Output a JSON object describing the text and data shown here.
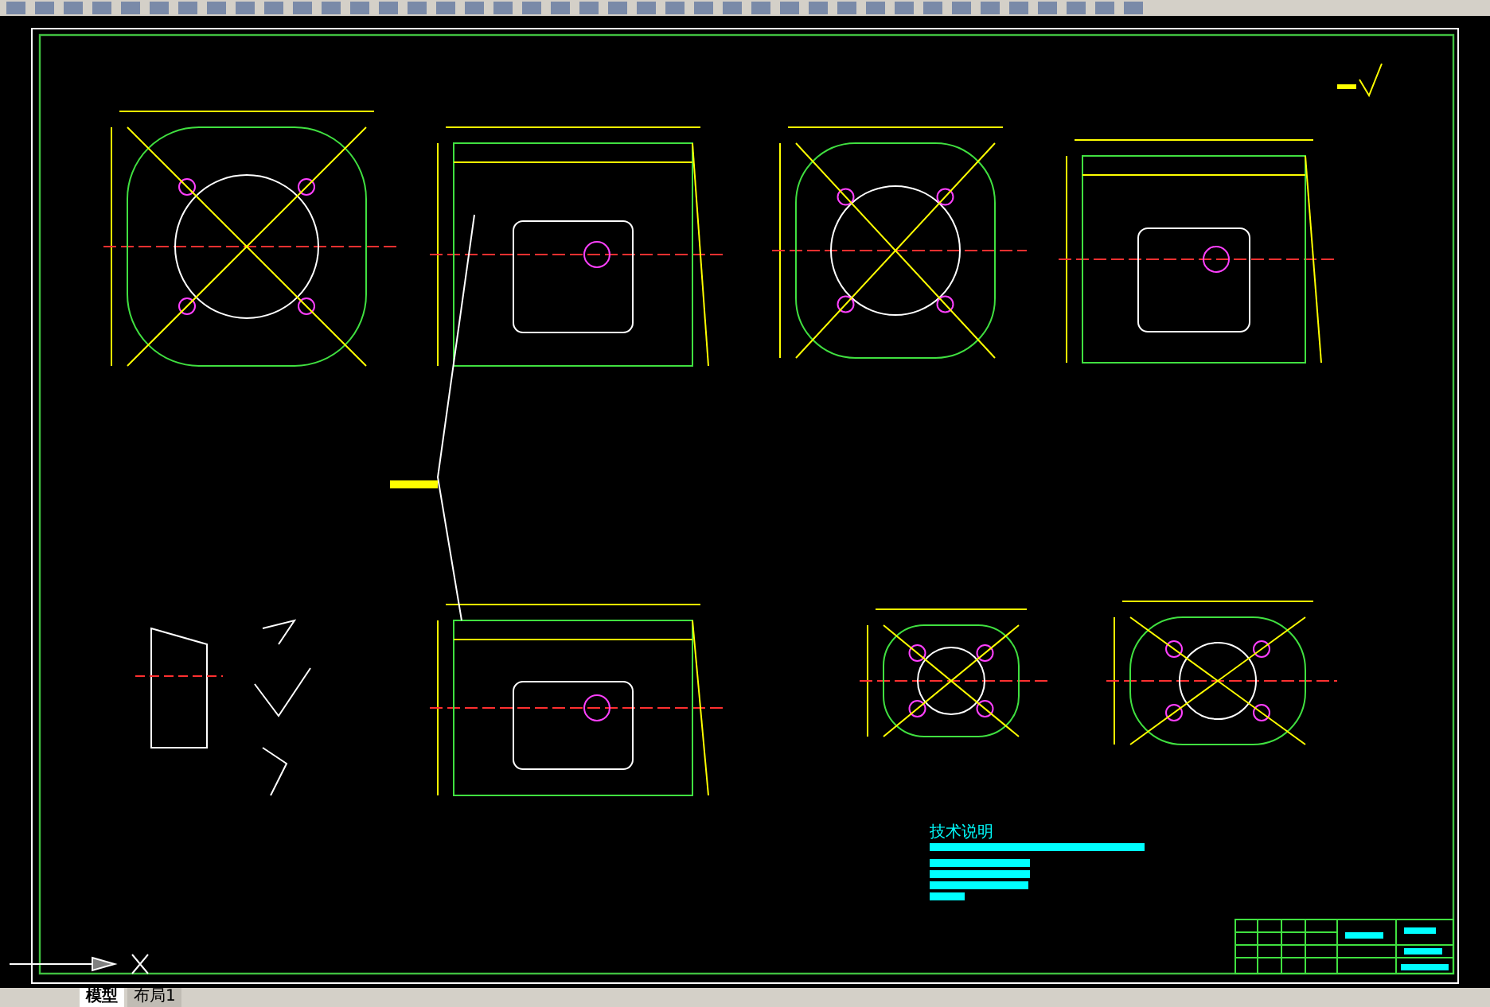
{
  "drawing": {
    "notes_heading": "技术说明"
  },
  "layout_tabs": [
    {
      "label": "模型",
      "selected": true
    },
    {
      "label": "布局1",
      "selected": false
    }
  ]
}
